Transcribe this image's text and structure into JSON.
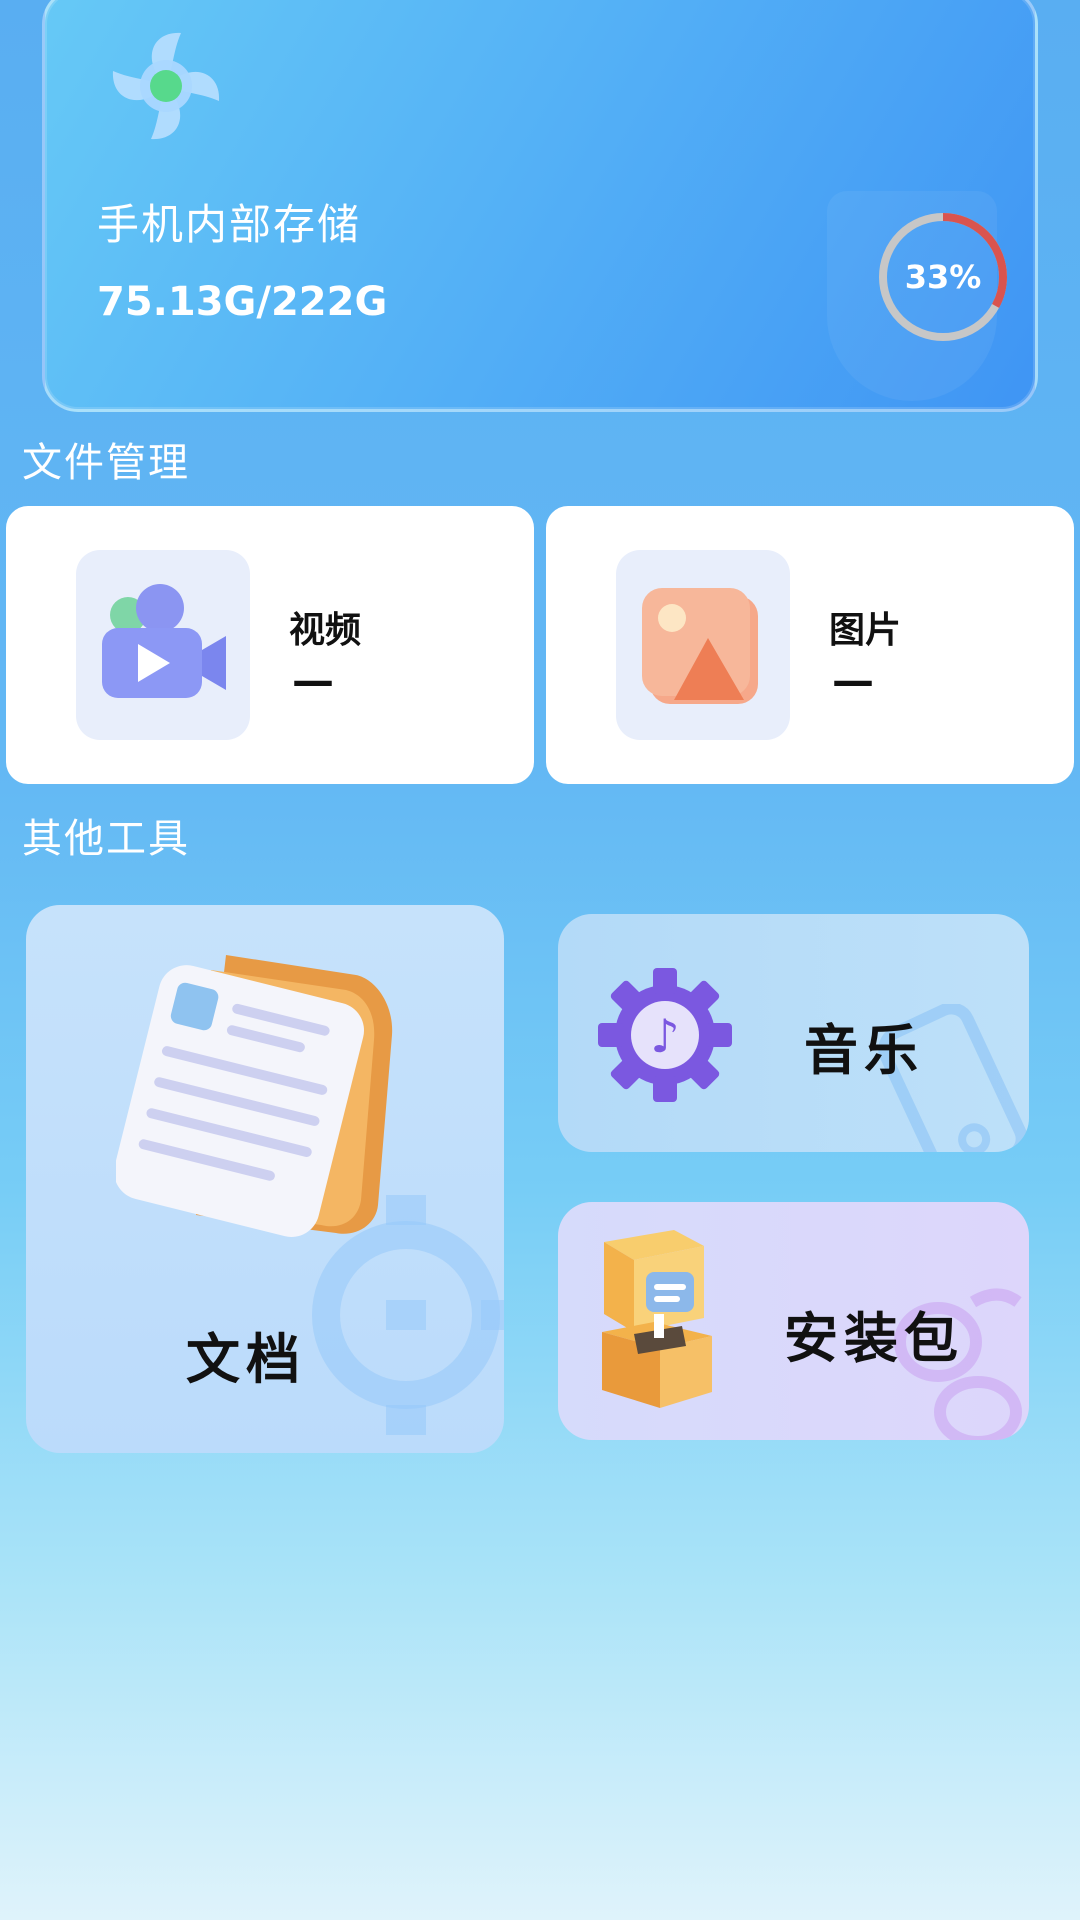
{
  "storage": {
    "title": "手机内部存储",
    "size": "75.13G/222G",
    "percent_label": "33%",
    "percent_value": 0.33
  },
  "file_management": {
    "title": "文件管理",
    "items": [
      {
        "label": "视频",
        "count": "—",
        "icon": "video-camera-icon"
      },
      {
        "label": "图片",
        "count": "—",
        "icon": "image-icon"
      }
    ]
  },
  "other_tools": {
    "title": "其他工具",
    "items": [
      {
        "label": "文档",
        "icon": "document-icon"
      },
      {
        "label": "音乐",
        "icon": "music-gear-icon"
      },
      {
        "label": "安装包",
        "icon": "package-box-icon"
      }
    ]
  },
  "colors": {
    "ring_progress": "#d9544f",
    "ring_track": "#c7c7c7",
    "accent_purple": "#7b58e0",
    "accent_orange": "#f2a44a"
  }
}
